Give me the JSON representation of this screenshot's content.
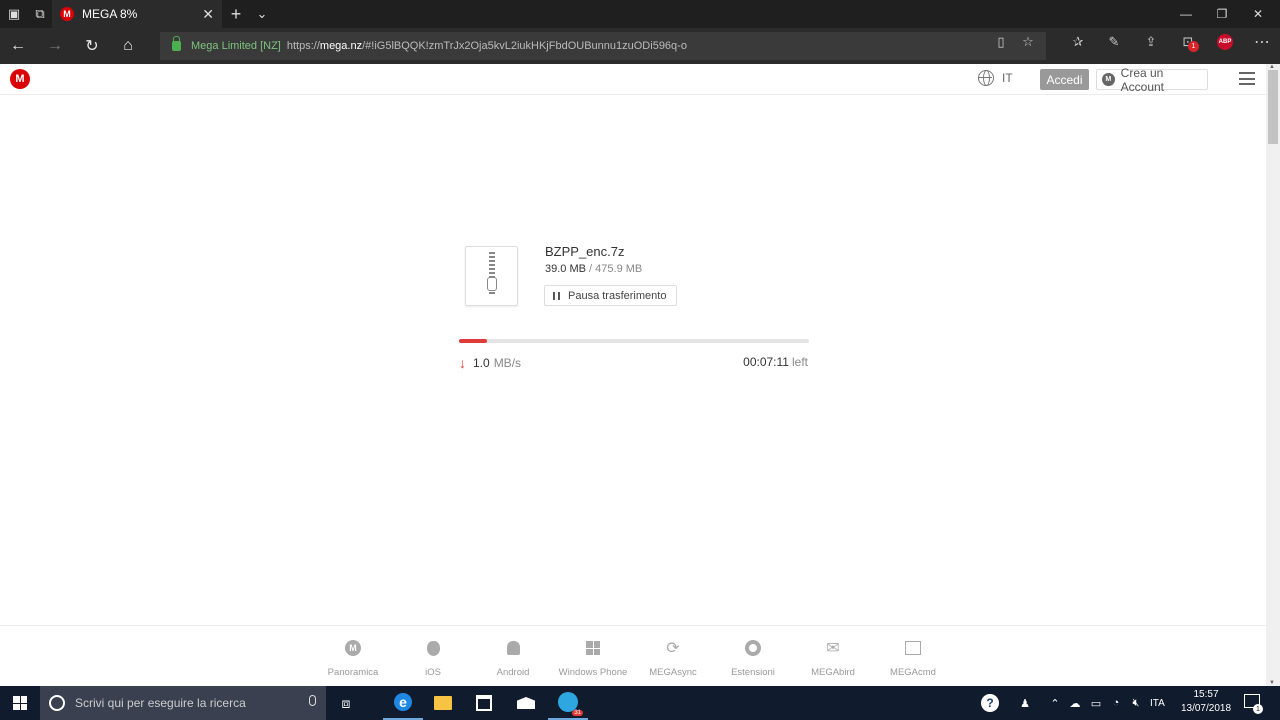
{
  "browser": {
    "tab_title": "MEGA 8%",
    "favicon_letter": "M",
    "site_identity": "Mega Limited [NZ]",
    "url_prefix": "https://",
    "url_domain": "mega.nz",
    "url_rest": "/#!iG5lBQQK!zmTrJx2Oja5kvL2iukHKjFbdOUBunnu1zuODi596q-o",
    "extension_badge_count": "1",
    "abp_label": "ABP"
  },
  "header": {
    "logo_letter": "M",
    "language": "IT",
    "login_label": "Accedi",
    "signup_label": "Crea un Account"
  },
  "download": {
    "file_name": "BZPP_enc.7z",
    "downloaded": "39.0 MB",
    "separator": "/",
    "total": "475.9 MB",
    "pause_label": "Pausa trasferimento",
    "progress_percent": 8,
    "speed_value": "1.0",
    "speed_unit": "MB/s",
    "time_remaining": "00:07:11",
    "time_suffix": "left",
    "accent_color": "#e03b3b"
  },
  "footer": {
    "items": [
      {
        "label": "Panoramica",
        "icon": "mega-icon"
      },
      {
        "label": "iOS",
        "icon": "apple-icon"
      },
      {
        "label": "Android",
        "icon": "android-icon"
      },
      {
        "label": "Windows Phone",
        "icon": "windows-icon"
      },
      {
        "label": "MEGAsync",
        "icon": "sync-icon"
      },
      {
        "label": "Estensioni",
        "icon": "chrome-icon"
      },
      {
        "label": "MEGAbird",
        "icon": "mail-icon"
      },
      {
        "label": "MEGAcmd",
        "icon": "terminal-icon"
      }
    ]
  },
  "taskbar": {
    "search_placeholder": "Scrivi qui per eseguire la ricerca",
    "telegram_badge": "31",
    "language": "ITA",
    "time": "15:57",
    "date": "13/07/2018",
    "notification_count": "1"
  }
}
